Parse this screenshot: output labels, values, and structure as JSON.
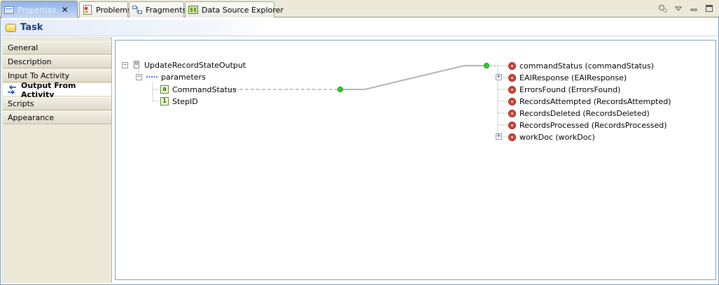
{
  "tabs": [
    {
      "label": "Properties",
      "active": true,
      "icon": "properties-icon",
      "closable": true
    },
    {
      "label": "Problems",
      "active": false,
      "icon": "problems-icon"
    },
    {
      "label": "Fragments",
      "active": false,
      "icon": "fragments-icon"
    },
    {
      "label": "Data Source Explorer",
      "active": false,
      "icon": "data-source-explorer-icon"
    }
  ],
  "view_tools": [
    "view-settings-icon",
    "view-menu-icon",
    "minimize-icon",
    "maximize-icon"
  ],
  "header": {
    "title": "Task",
    "icon": "task-icon"
  },
  "sidebar": {
    "items": [
      {
        "label": "General"
      },
      {
        "label": "Description"
      },
      {
        "label": "Input To Activity"
      },
      {
        "label": "Output From Activity",
        "active": true,
        "icon": "mapping-arrows-icon"
      },
      {
        "label": "Scripts"
      },
      {
        "label": "Appearance"
      }
    ]
  },
  "mapping": {
    "source": {
      "root": "UpdateRecordStateOutput",
      "group": "parameters",
      "params": [
        {
          "label": "CommandStatus",
          "type_badge": "a"
        },
        {
          "label": "StepID",
          "type_badge": "1"
        }
      ]
    },
    "target": {
      "fields": [
        {
          "label": "commandStatus (commandStatus)",
          "expandable": false,
          "mapped": true
        },
        {
          "label": "EAIResponse (EAIResponse)",
          "expandable": true
        },
        {
          "label": "ErrorsFound (ErrorsFound)",
          "expandable": false
        },
        {
          "label": "RecordsAttempted (RecordsAttempted)",
          "expandable": false
        },
        {
          "label": "RecordsDeleted (RecordsDeleted)",
          "expandable": false
        },
        {
          "label": "RecordsProcessed (RecordsProcessed)",
          "expandable": false
        },
        {
          "label": "workDoc (workDoc)",
          "expandable": true
        }
      ]
    },
    "mappings": [
      {
        "from": "CommandStatus",
        "to": "commandStatus (commandStatus)"
      }
    ]
  },
  "colors": {
    "accent": "#1c3f7a",
    "connector": "#b5b5b5",
    "endpoint": "#2ecc2e"
  }
}
